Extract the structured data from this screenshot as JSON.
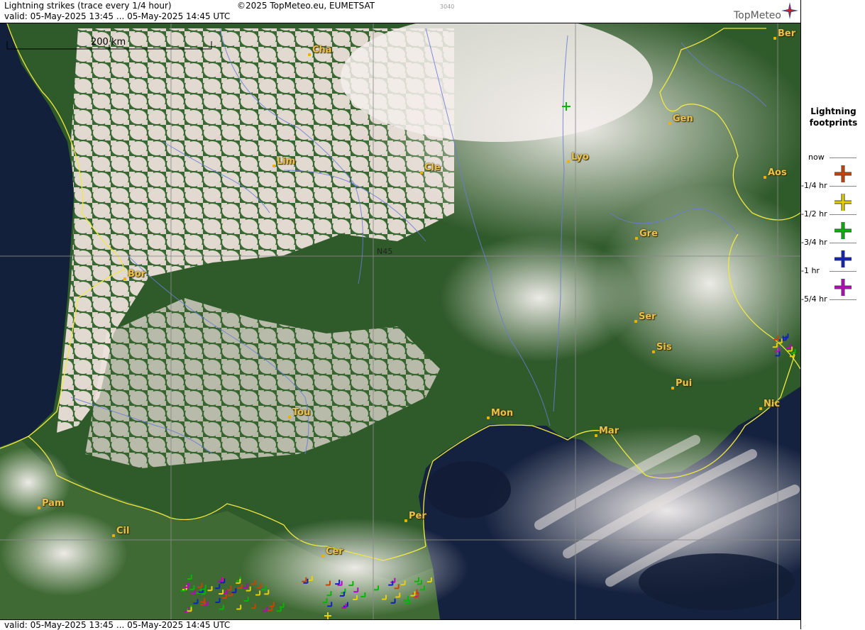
{
  "header": {
    "title": "Lightning strikes (trace every 1/4 hour)",
    "copyright": "©2025 TopMeteo.eu, EUMETSAT",
    "code": "3040",
    "valid": "valid:  05-May-2025 13:45 ... 05-May-2025 14:45 UTC",
    "logo": "TopMeteo"
  },
  "footer": {
    "valid": "valid:  05-May-2025 13:45 ... 05-May-2025 14:45 UTC"
  },
  "map": {
    "scale_label": "200 km",
    "grid_label": "N45",
    "cities": [
      "Cha",
      "Ber",
      "Gen",
      "Lim",
      "Cle",
      "Lyo",
      "Aos",
      "Gre",
      "Bor",
      "Ser",
      "Sis",
      "Pui",
      "Nic",
      "Tou",
      "Mon",
      "Mar",
      "Pam",
      "Cil",
      "Per",
      "Cer"
    ]
  },
  "legend": {
    "title_line1": "Lightning",
    "title_line2": "footprints",
    "now": "now",
    "items": [
      {
        "label": "-1/4 hr",
        "color": "#d04000"
      },
      {
        "label": "-1/2 hr",
        "color": "#e8d000"
      },
      {
        "label": "-3/4 hr",
        "color": "#00b800"
      },
      {
        "label": "-1 hr",
        "color": "#1020c0"
      },
      {
        "label": "-5/4 hr",
        "color": "#c000c0"
      }
    ]
  },
  "colors": {
    "sea": "#15223f",
    "land": "#2f5a2a",
    "cloud": "#f1e6e1",
    "border": "#f0e840",
    "river": "#6a7cd8",
    "grid": "#8a8a8a"
  }
}
